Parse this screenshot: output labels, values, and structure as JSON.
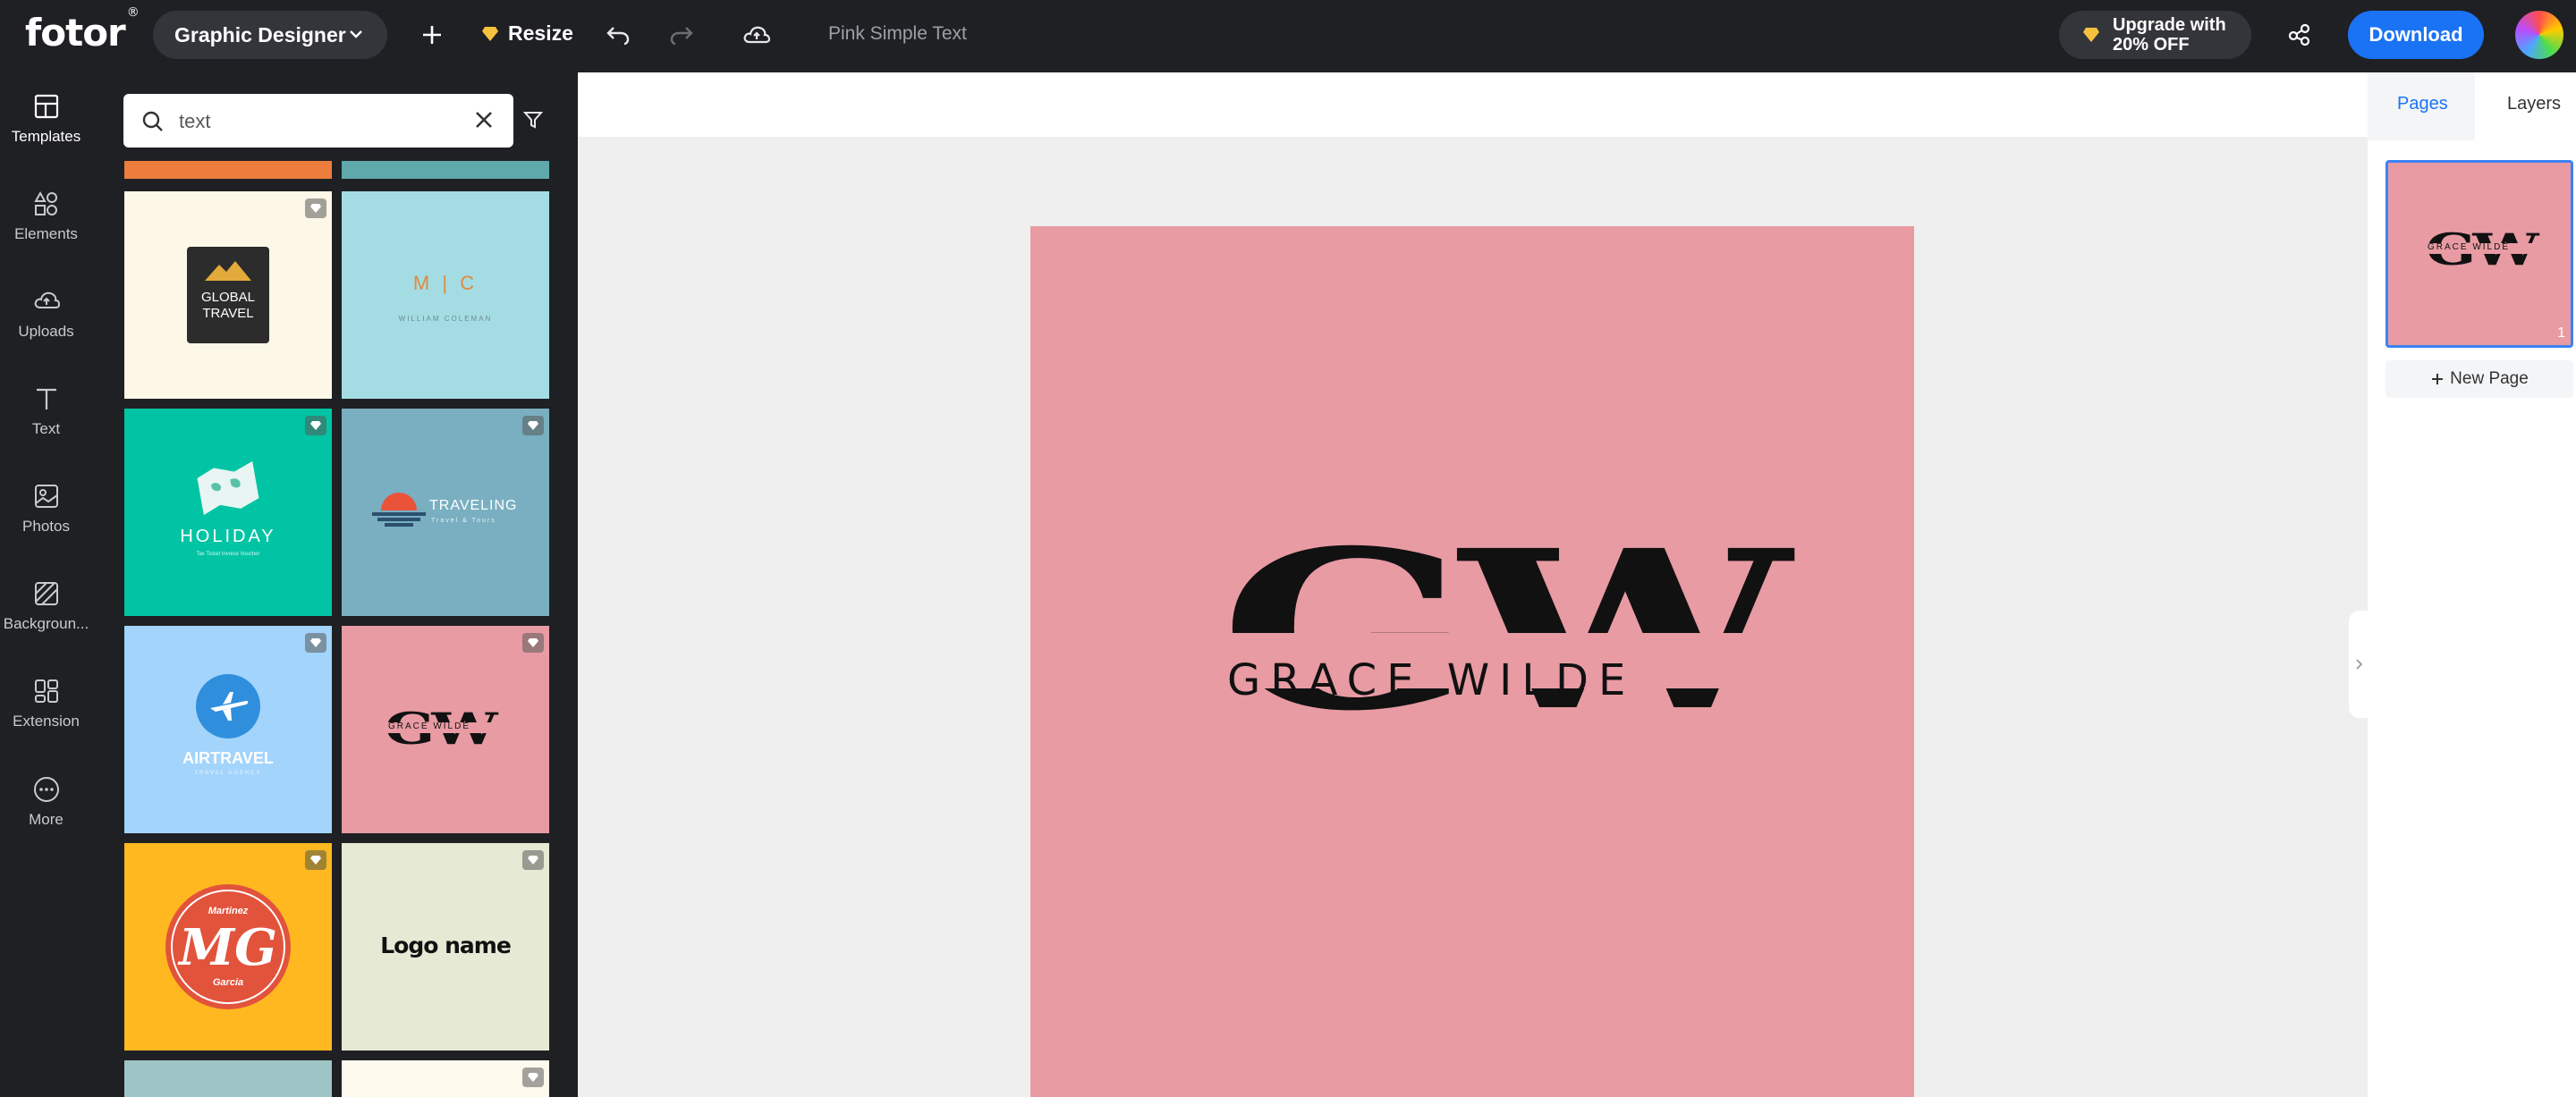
{
  "app": {
    "logo": "fotor",
    "logo_mark": "®"
  },
  "topbar": {
    "design_type": "Graphic Designer",
    "resize_label": "Resize",
    "doc_name": "Pink Simple Text",
    "upgrade_line1": "Upgrade with",
    "upgrade_line2": "20% OFF",
    "download_label": "Download",
    "icons": [
      "plus-icon",
      "undo-icon",
      "redo-icon",
      "cloud-save-icon",
      "share-icon"
    ]
  },
  "rail": {
    "items": [
      {
        "label": "Templates",
        "icon": "templates-icon"
      },
      {
        "label": "Elements",
        "icon": "elements-icon"
      },
      {
        "label": "Uploads",
        "icon": "uploads-icon"
      },
      {
        "label": "Text",
        "icon": "text-icon"
      },
      {
        "label": "Photos",
        "icon": "photos-icon"
      },
      {
        "label": "Backgroun...",
        "icon": "background-icon"
      },
      {
        "label": "Extension",
        "icon": "extension-icon"
      },
      {
        "label": "More",
        "icon": "more-icon"
      }
    ]
  },
  "search": {
    "value": "text"
  },
  "templates": [
    {
      "line1": "GLOBAL",
      "line2": "TRAVEL",
      "bg": "#fdf7e8"
    },
    {
      "line1": "M | C",
      "line2": "WILLIAM COLEMAN",
      "bg": "#a3dde3"
    },
    {
      "line1": "HOLIDAY",
      "line2": "Tax Ticket Invoice Voucher",
      "bg": "#00c4a3"
    },
    {
      "line1": "TRAVELING",
      "line2": "Travel & Tours",
      "bg": "#79afc1"
    },
    {
      "line1": "AIRTRAVEL",
      "line2": "TRAVEL AGENCY",
      "bg": "#a3d4fb"
    },
    {
      "line1": "GW",
      "line2": "GRACE WILDE",
      "bg": "#e89ba3"
    },
    {
      "line1": "MG",
      "line2a": "Martinez",
      "line2b": "Garcia",
      "bg": "#ffb81f"
    },
    {
      "line1": "Logo name",
      "bg": "#e6e9d4"
    }
  ],
  "canvas": {
    "monogram": "GW",
    "name": "GRACE WILDE",
    "bg": "#e89ba3"
  },
  "pages_panel": {
    "tab_pages": "Pages",
    "tab_layers": "Layers",
    "page_number": "1",
    "new_page": "New Page"
  },
  "colors": {
    "accent": "#1a73f5",
    "dark": "#1f2024",
    "artboard": "#e89ba3"
  }
}
